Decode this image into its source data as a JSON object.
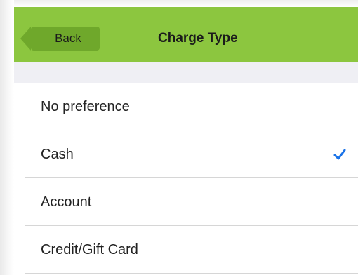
{
  "nav": {
    "back_label": "Back",
    "title": "Charge Type"
  },
  "options": [
    {
      "label": "No preference",
      "selected": false
    },
    {
      "label": "Cash",
      "selected": true
    },
    {
      "label": "Account",
      "selected": false
    },
    {
      "label": "Credit/Gift Card",
      "selected": false
    }
  ],
  "colors": {
    "nav_bar": "#8cc63f",
    "back_button": "#6fa82b",
    "checkmark": "#1a73e8"
  },
  "icons": {
    "selected_indicator": "checkmark-icon"
  }
}
